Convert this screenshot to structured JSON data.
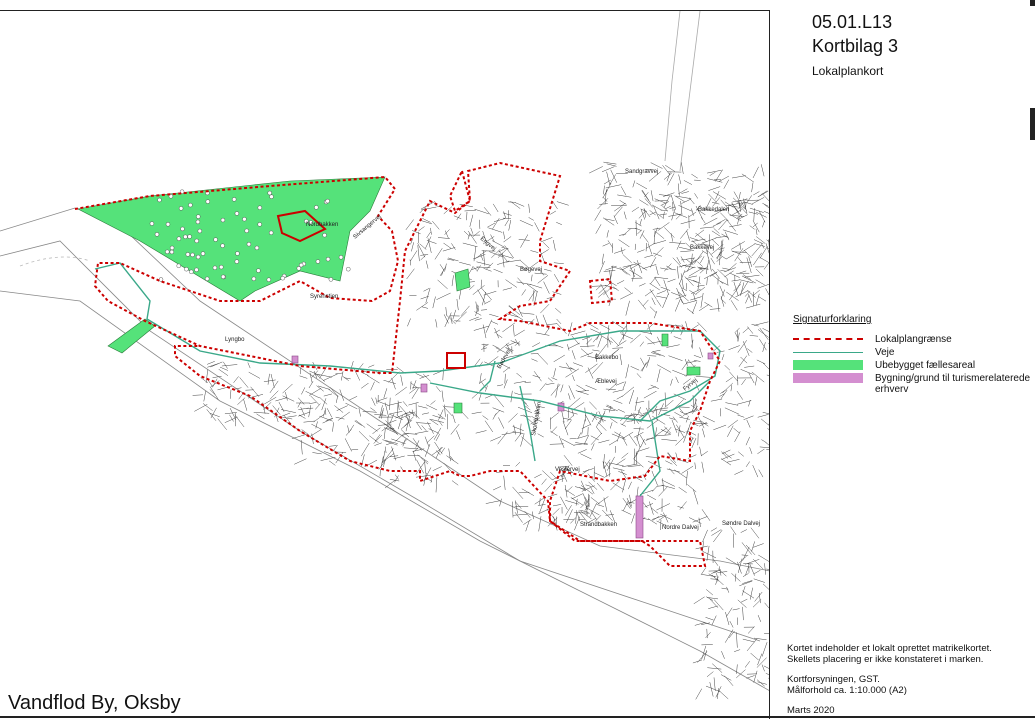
{
  "header": {
    "plan_code": "05.01.L13",
    "map_title": "Kortbilag 3",
    "map_subtitle": "Lokalplankort"
  },
  "legend": {
    "title": "Signaturforklaring",
    "items": [
      {
        "label": "Lokalplangrænse",
        "symbol": "dashed-red-line",
        "color": "#cc0000"
      },
      {
        "label": "Veje",
        "symbol": "teal-line",
        "color": "#3aa889"
      },
      {
        "label": "Ubebygget fællesareal",
        "symbol": "green-fill",
        "color": "#55e27a"
      },
      {
        "label": "Bygning/grund til turismerelaterede erhverv",
        "symbol": "pink-fill",
        "color": "#d48fd0"
      }
    ]
  },
  "notes": {
    "line1": "Kortet indeholder et lokalt oprettet matrikelkortet.",
    "line2": "Skellets placering er ikke konstateret i marken.",
    "line3": "Kortforsyningen, GST.",
    "line4": "Målforhold ca. 1:10.000 (A2)",
    "line5": "Marts 2020"
  },
  "place_name": "Vandflod By, Oksby",
  "streets": {
    "s1": "Nordbakken",
    "s2": "Sivsangervej",
    "s3": "Syrenstien",
    "s4": "Lyngbo",
    "s5": "Bøgevej",
    "s6": "Bakkebo",
    "s7": "Badevej",
    "s8": "Skolebakken",
    "s9": "Bakkedalen",
    "s10": "Bakkevej",
    "s11": "Sandgravvej",
    "s12": "Strandbakken",
    "s13": "Nordre Dalvej",
    "s14": "Søndre Dalvej",
    "s15": "Engvej",
    "s16": "Vestervej",
    "s17": "Æblevej",
    "s18": "Fyrvej"
  }
}
